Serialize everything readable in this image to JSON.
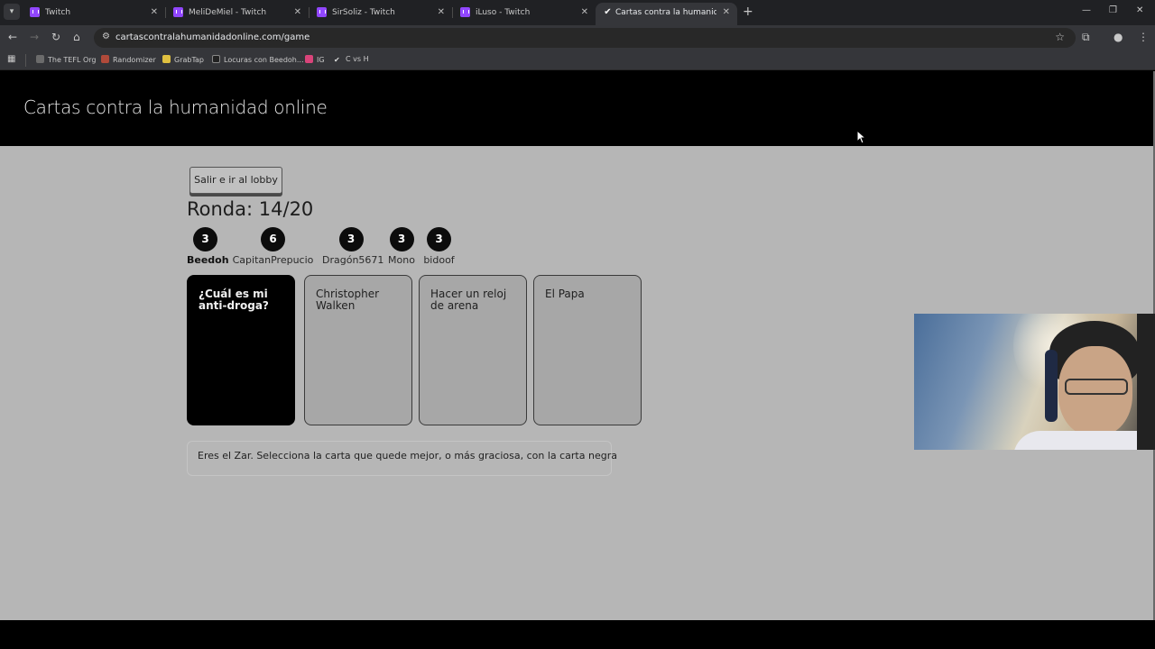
{
  "browser": {
    "tabs": [
      {
        "title": "Twitch",
        "favicon": "twitch-icon",
        "active": false
      },
      {
        "title": "MeliDeMiel - Twitch",
        "favicon": "twitch-icon",
        "active": false
      },
      {
        "title": "SirSoliz - Twitch",
        "favicon": "twitch-icon",
        "active": false
      },
      {
        "title": "iLuso - Twitch",
        "favicon": "twitch-icon",
        "active": false
      },
      {
        "title": "Cartas contra la humanidad onl",
        "favicon": "cah-icon",
        "active": true
      }
    ],
    "url": "cartascontralahumanidadonline.com/game",
    "bookmarks": [
      {
        "label": "The TEFL Org",
        "color": "#6b6b6b"
      },
      {
        "label": "Randomizer",
        "color": "#b04a3a"
      },
      {
        "label": "GrabTap",
        "color": "#e0c040"
      },
      {
        "label": "Locuras con Beedoh...",
        "color": "#222222"
      },
      {
        "label": "IG",
        "color": "#d9447a"
      },
      {
        "label": "C vs H",
        "color": "#dddddd"
      }
    ]
  },
  "page": {
    "site_title": "Cartas contra la humanidad online",
    "lobby_button": "Salir e ir al lobby",
    "round_label": "Ronda: ",
    "round_value": "14/20",
    "players": [
      {
        "score": "3",
        "name": "Beedoh",
        "czar": true
      },
      {
        "score": "6",
        "name": "CapitanPrepucio",
        "czar": false
      },
      {
        "score": "3",
        "name": "Dragón5671",
        "czar": false
      },
      {
        "score": "3",
        "name": "Mono",
        "czar": false
      },
      {
        "score": "3",
        "name": "bidoof",
        "czar": false
      }
    ],
    "black_card": "¿Cuál es mi anti-droga?",
    "white_cards": [
      "Christopher Walken",
      "Hacer un reloj de arena",
      "El Papa"
    ],
    "instruction": "Eres el Zar. Selecciona la carta que quede mejor, o más graciosa, con la carta negra"
  },
  "colors": {
    "page_bg": "#b6b6b6",
    "header_bg": "#000000",
    "black_card": "#000000",
    "white_card": "#a7a7a7"
  }
}
